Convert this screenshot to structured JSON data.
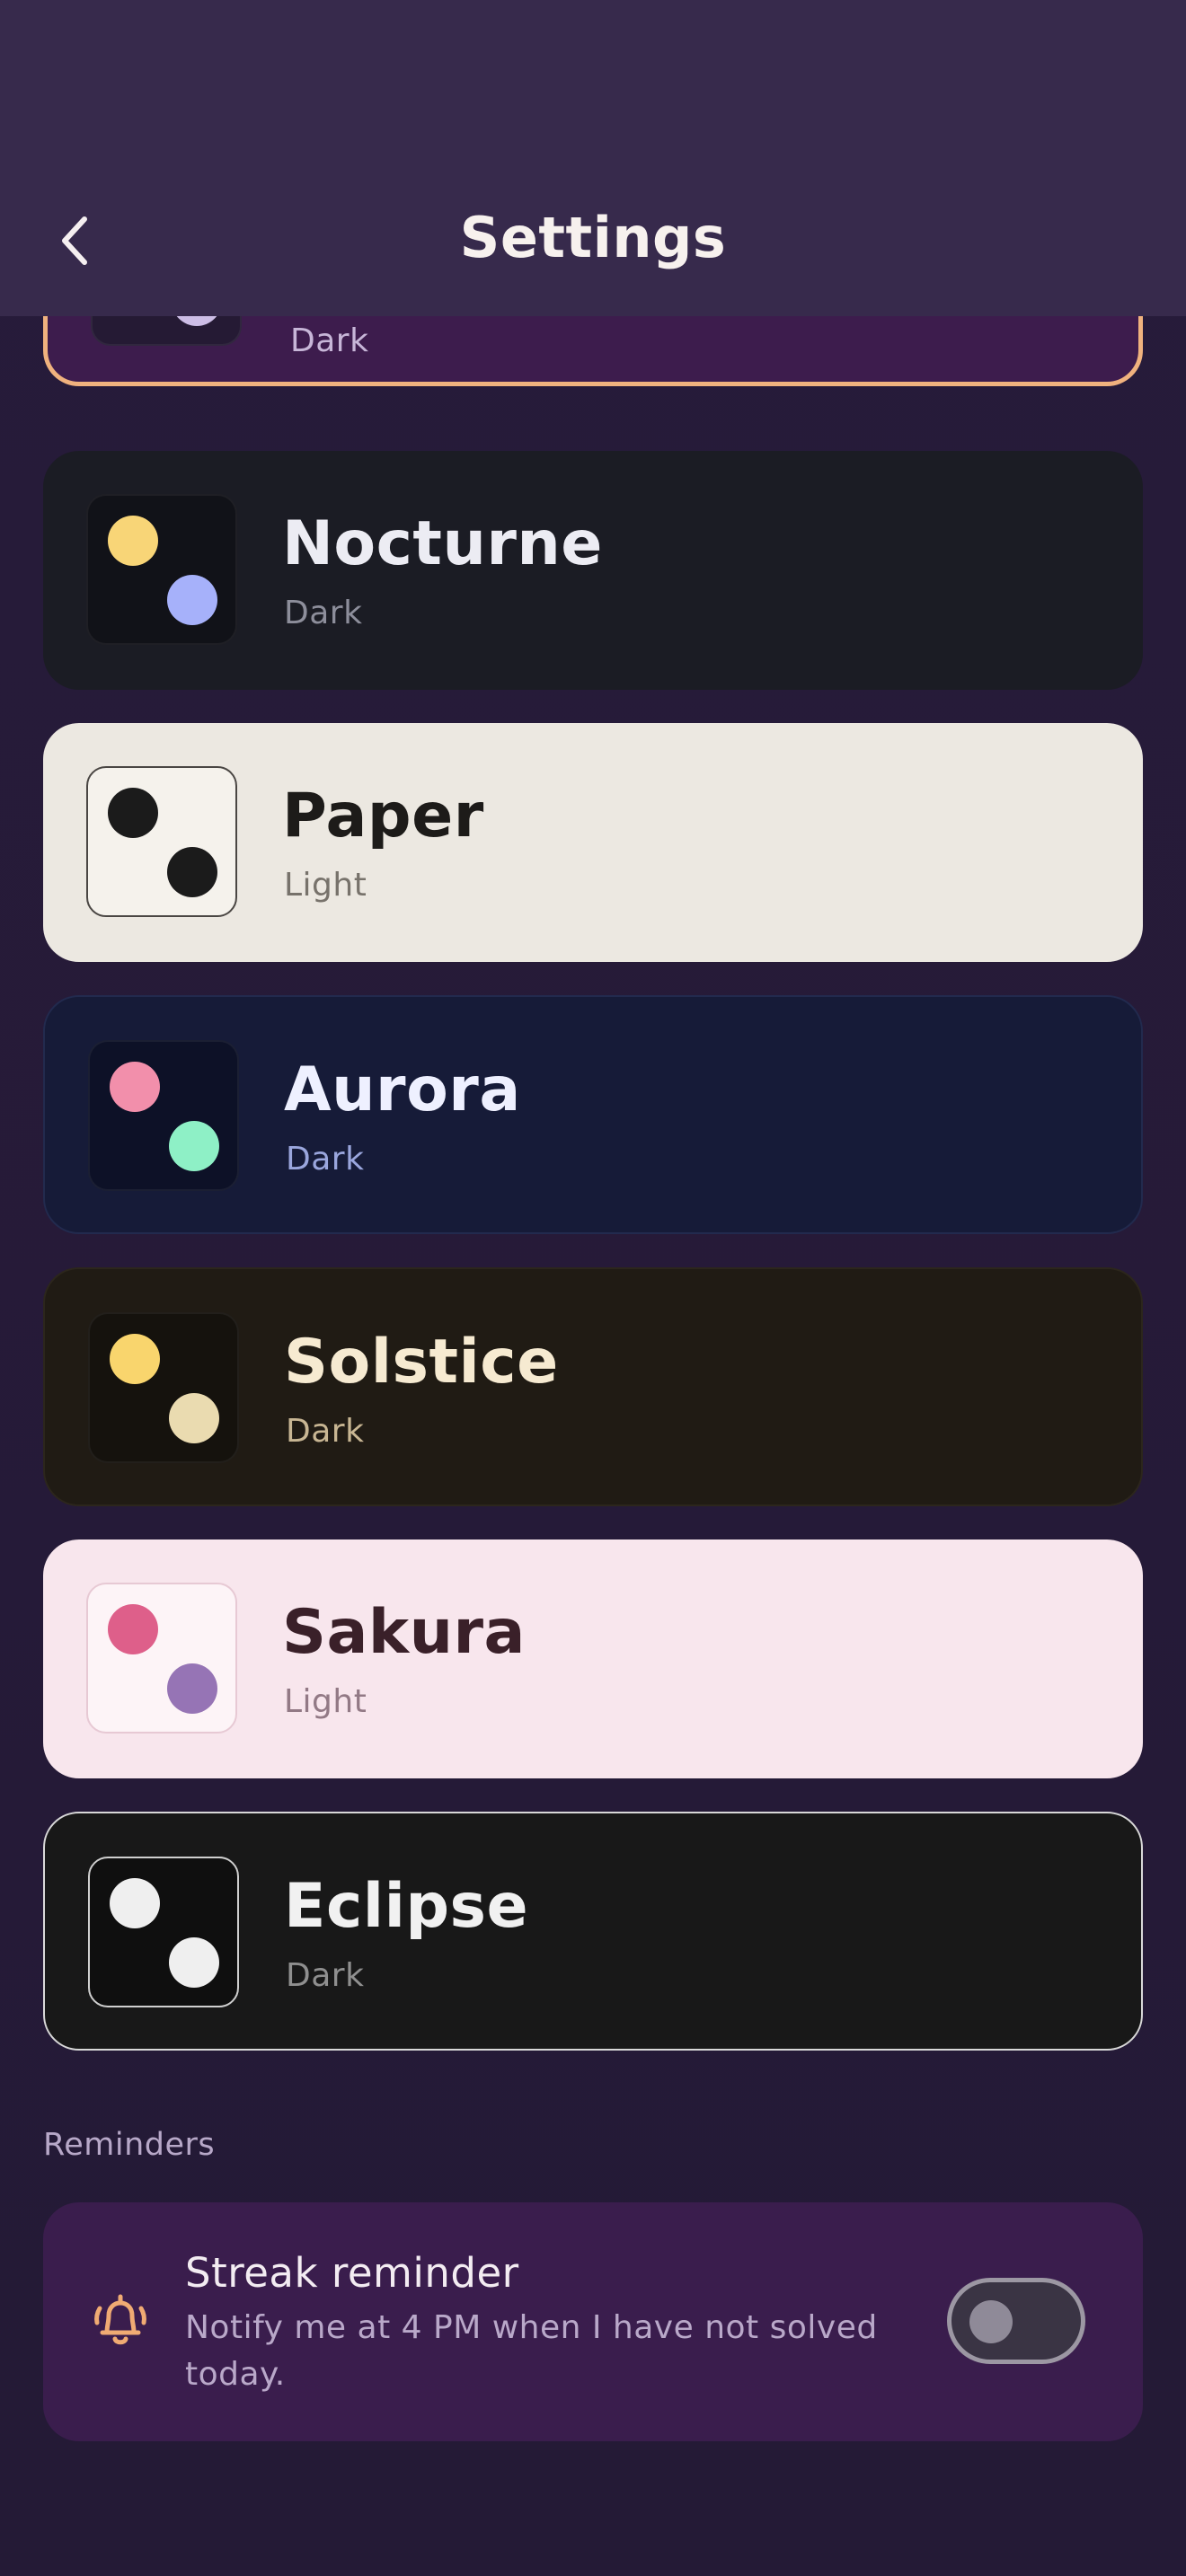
{
  "header": {
    "title": "Settings",
    "back_icon": "chevron-left-icon"
  },
  "themes": [
    {
      "name": "",
      "mode": "Dark",
      "colors": {
        "bg": "#3d1c4d",
        "border": "#f0b27e",
        "swatch_bg": "#251a34",
        "dot1": "#cdbde6",
        "dot2": "#cdbde6",
        "mode_color": "#c7b6d8"
      },
      "selected": true
    },
    {
      "name": "Nocturne",
      "mode": "Dark",
      "colors": {
        "bg": "#1b1c24",
        "swatch_bg": "#111218",
        "dot1": "#f8d577",
        "dot2": "#a6b1fa",
        "name_color": "#ececf3",
        "mode_color": "#8d8e9b"
      }
    },
    {
      "name": "Paper",
      "mode": "Light",
      "colors": {
        "bg": "#ece8e1",
        "swatch_bg": "#f5f2ec",
        "dot1": "#1b1b1b",
        "dot2": "#1b1b1b",
        "name_color": "#1d1b19",
        "mode_color": "#77726b"
      }
    },
    {
      "name": "Aurora",
      "mode": "Dark",
      "colors": {
        "bg": "#161b38",
        "swatch_bg": "#0d1127",
        "dot1": "#f28fab",
        "dot2": "#8ef0c6",
        "name_color": "#eef0ff",
        "mode_color": "#9aa6dd"
      }
    },
    {
      "name": "Solstice",
      "mode": "Dark",
      "colors": {
        "bg": "#201b14",
        "swatch_bg": "#15120d",
        "dot1": "#f9d56d",
        "dot2": "#eadbb0",
        "name_color": "#f6ead1",
        "mode_color": "#c8b693"
      }
    },
    {
      "name": "Sakura",
      "mode": "Light",
      "colors": {
        "bg": "#f8e6ed",
        "swatch_bg": "#fdf4f7",
        "dot1": "#de5f8a",
        "dot2": "#9674b5",
        "name_color": "#3a2029",
        "mode_color": "#927985"
      }
    },
    {
      "name": "Eclipse",
      "mode": "Dark",
      "colors": {
        "bg": "#181818",
        "swatch_bg": "#0f0f0f",
        "dot1": "#efefef",
        "dot2": "#efefef",
        "name_color": "#f1f1f1",
        "mode_color": "#8f8f8f"
      }
    }
  ],
  "reminders": {
    "section_label": "Reminders",
    "title": "Streak reminder",
    "description": "Notify me at 4 PM when I have not solved today.",
    "icon": "bell-icon",
    "toggle_on": false
  }
}
